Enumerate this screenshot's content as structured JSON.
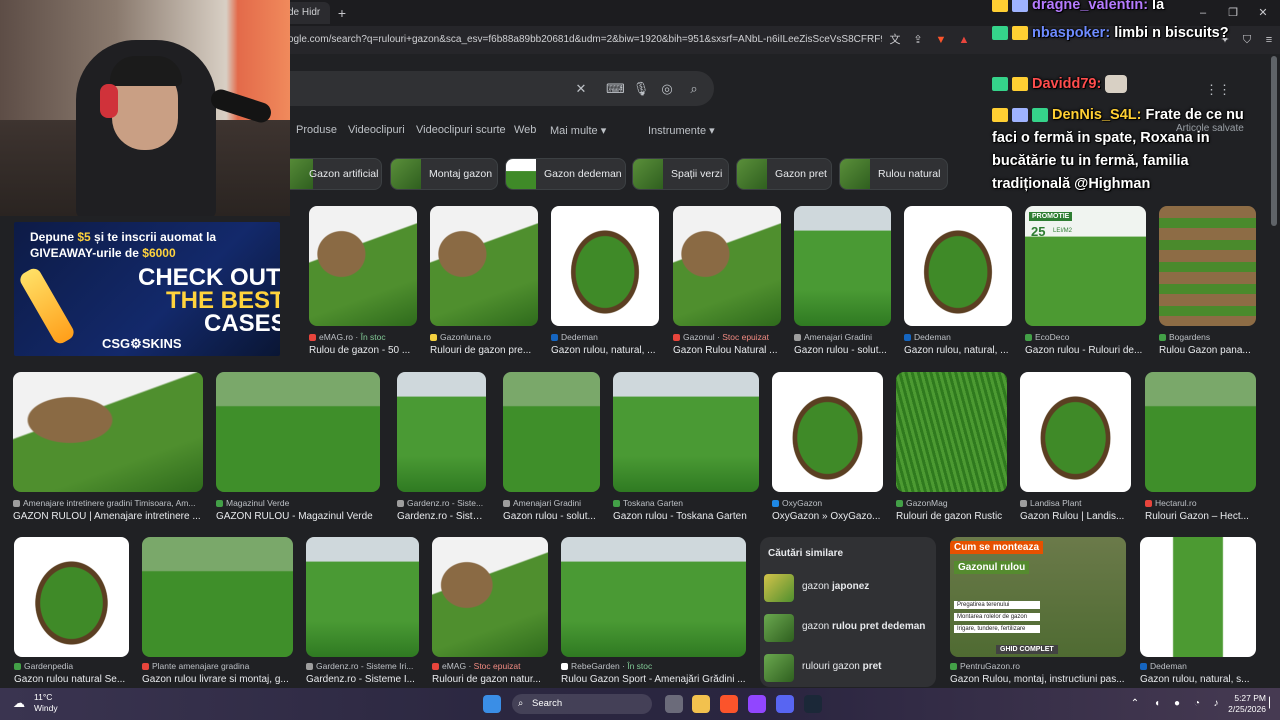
{
  "browser": {
    "tab_title": "de Hidr",
    "new_tab": "+",
    "url": "ogle.com/search?q=rulouri+gazon&sca_esv=f6b88a89bb20681d&udm=2&biw=1920&bih=951&sxsrf=ANbL-n6iILeeZisSceVsS8CFRF9ZWOZ..."
  },
  "filters": [
    "Produse",
    "Videoclipuri",
    "Videoclipuri scurte",
    "Web",
    "Mai multe ▾",
    "Instrumente ▾"
  ],
  "saved_label": "Articole salvate",
  "chips": [
    "Gazon artificial",
    "Montaj gazon",
    "Gazon dedeman",
    "Spații verzi",
    "Gazon pret",
    "Rulou natural"
  ],
  "results": [
    {
      "source": "eMAG.ro",
      "stock": "În stoc",
      "stock_state": "in",
      "title": "Rulou de gazon - 50 ..."
    },
    {
      "source": "Gazonluna.ro",
      "stock": "",
      "stock_state": "",
      "title": "Rulouri de gazon pre..."
    },
    {
      "source": "Dedeman",
      "stock": "",
      "stock_state": "",
      "title": "Gazon rulou, natural, ..."
    },
    {
      "source": "Gazonul",
      "stock": "Stoc epuizat",
      "stock_state": "out",
      "title": "Gazon Rulou Natural ..."
    },
    {
      "source": "Amenajari Gradini",
      "stock": "",
      "stock_state": "",
      "title": "Gazon rulou - solut..."
    },
    {
      "source": "Dedeman",
      "stock": "",
      "stock_state": "",
      "title": "Gazon rulou, natural, ..."
    },
    {
      "source": "EcoDeco",
      "stock": "",
      "stock_state": "",
      "title": "Gazon rulou - Rulouri de..."
    },
    {
      "source": "Bogardens",
      "stock": "",
      "stock_state": "",
      "title": "Rulou Gazon pana..."
    },
    {
      "source": "Amenajare intretinere gradini Timisoara, Am...",
      "stock": "",
      "stock_state": "",
      "title": "GAZON RULOU | Amenajare intretinere ..."
    },
    {
      "source": "Magazinul Verde",
      "stock": "",
      "stock_state": "",
      "title": "GAZON RULOU - Magazinul Verde"
    },
    {
      "source": "Gardenz.ro - Siste...",
      "stock": "",
      "stock_state": "",
      "title": "Gardenz.ro - Siste..."
    },
    {
      "source": "Amenajari Gradini",
      "stock": "",
      "stock_state": "",
      "title": "Gazon rulou - solut..."
    },
    {
      "source": "Toskana Garten",
      "stock": "",
      "stock_state": "",
      "title": "Gazon rulou - Toskana Garten"
    },
    {
      "source": "OxyGazon",
      "stock": "",
      "stock_state": "",
      "title": "OxyGazon » OxyGazo..."
    },
    {
      "source": "GazonMag",
      "stock": "",
      "stock_state": "",
      "title": "Rulouri de gazon Rustic"
    },
    {
      "source": "Landisa Plant",
      "stock": "",
      "stock_state": "",
      "title": "Gazon Rulou | Landis..."
    },
    {
      "source": "Hectarul.ro",
      "stock": "",
      "stock_state": "",
      "title": "Rulouri Gazon – Hect..."
    },
    {
      "source": "Gardenpedia",
      "stock": "",
      "stock_state": "",
      "title": "Gazon rulou natural Se..."
    },
    {
      "source": "Plante amenajare gradina",
      "stock": "",
      "stock_state": "",
      "title": "Gazon rulou livrare si montaj, g..."
    },
    {
      "source": "Gardenz.ro - Sisteme Iri...",
      "stock": "",
      "stock_state": "",
      "title": "Gardenz.ro - Sisteme I..."
    },
    {
      "source": "eMAG",
      "stock": "Stoc epuizat",
      "stock_state": "out",
      "title": "Rulouri de gazon natur..."
    },
    {
      "source": "RebeGarden",
      "stock": "În stoc",
      "stock_state": "in",
      "title": "Rulou Gazon Sport - Amenajări Grădini ..."
    },
    {
      "source": "PentruGazon.ro",
      "stock": "",
      "stock_state": "",
      "title": "Gazon Rulou, montaj, instructiuni pas..."
    },
    {
      "source": "Dedeman",
      "stock": "",
      "stock_state": "",
      "title": "Gazon rulou, natural, s..."
    }
  ],
  "similar": {
    "heading": "Căutări similare",
    "items": [
      {
        "pre": "gazon ",
        "bold": "japonez"
      },
      {
        "pre": "gazon ",
        "bold": "rulou pret dedeman"
      },
      {
        "pre": "rulouri gazon ",
        "bold": "pret"
      }
    ]
  },
  "promo_overlay": {
    "banner": "Cum se monteaza",
    "sub": "Gazonul rulou",
    "steps": [
      "Pregatirea terenului",
      "Montarea rolelor de gazon",
      "Irigare, tundere, fertilizare"
    ],
    "footer": "GHID COMPLET"
  },
  "promo_card": {
    "line1": "PROMOTIE",
    "price": "25",
    "unit": "LEI/M2"
  },
  "ad": {
    "line1_pre": "Depune ",
    "line1_amount": "$5",
    "line1_post": " și te inscrii auomat la",
    "line2_pre": "GIVEAWAY-urile de ",
    "line2_amount": "$6000",
    "big1": "CHECK OUT",
    "big2": "THE BEST",
    "big3": "CASES",
    "brand": "CSG⚙SKINS"
  },
  "chat": [
    {
      "user": "dragne_valentin:",
      "text": " la"
    },
    {
      "user": "nbaspoker:",
      "text": " limbi n biscuits?"
    },
    {
      "user": "Davidd79:",
      "text": ""
    },
    {
      "user": "DenNis_S4L:",
      "text": " Frate de ce nu faci o fermă in spate, Roxana in bucătărie tu in fermă, familia tradițională @Highman"
    }
  ],
  "taskbar": {
    "temp": "11°C",
    "weather": "Windy",
    "search": "Search",
    "time": "5:27 PM",
    "date": "2/25/2026"
  },
  "colors": {
    "page_bg": "#202124",
    "chip_bg": "#303134",
    "link_text": "#e8eaed",
    "in_stock": "#81c995",
    "out_stock": "#f28b82"
  }
}
